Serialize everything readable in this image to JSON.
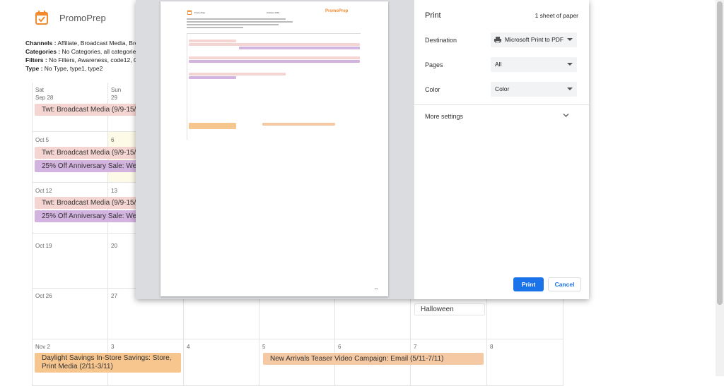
{
  "app": {
    "title": "PromoPrep"
  },
  "filters": {
    "channels_label": "Channels :",
    "channels_value": "Affiliate, Broadcast Media, Broadca",
    "categories_label": "Categories :",
    "categories_value": "No Categories, all categories, all c",
    "filters_label": "Filters :",
    "filters_value": "No Filters, Awareness, code12, Consid",
    "type_label": "Type :",
    "type_value": "No Type, type1, type2"
  },
  "calendar": {
    "days": {
      "sat_header": "Sat",
      "sun_header": "Sun",
      "sep28": "Sep 28",
      "sep29": "29",
      "oct5": "Oct 5",
      "oct6": "6",
      "oct12": "Oct 12",
      "oct13": "13",
      "oct19": "Oct 19",
      "oct20": "20",
      "oct26": "Oct 26",
      "oct27": "27",
      "nov2": "Nov 2",
      "nov3": "3",
      "nov4": "4",
      "nov5": "5",
      "nov6": "6",
      "nov7": "7",
      "nov8": "8"
    },
    "events": {
      "broadcast_1": "Twt: Broadcast Media (9/9-15/",
      "broadcast_2": "Twt: Broadcast Media (9/9-15/",
      "anniversary_1": "25% Off Anniversary Sale: Web",
      "broadcast_3": "Twt: Broadcast Media (9/9-15/",
      "anniversary_2": "25% Off Anniversary Sale: Web",
      "halloween": "Halloween",
      "daylight": "Daylight Savings In-Store Savings: Store, Print Media (2/11-3/11)",
      "new_arrivals": "New Arrivals Teaser Video Campaign: Email (5/11-7/11)"
    }
  },
  "print_dialog": {
    "title": "Print",
    "sheet_count": "1 sheet of paper",
    "destination_label": "Destination",
    "destination_value": "Microsoft Print to PDF",
    "pages_label": "Pages",
    "pages_value": "All",
    "color_label": "Color",
    "color_value": "Color",
    "more_settings": "More settings",
    "print_button": "Print",
    "cancel_button": "Cancel",
    "preview": {
      "app_name": "PromoPrep",
      "month": "October 2019",
      "brand": "PromoPrep",
      "page_number": "1/1"
    }
  },
  "colors": {
    "accent": "#1a73e8",
    "brand": "#f28a2e",
    "pink": "#f5d5d1",
    "purple": "#d3b3df",
    "orange": "#f7c68f"
  }
}
